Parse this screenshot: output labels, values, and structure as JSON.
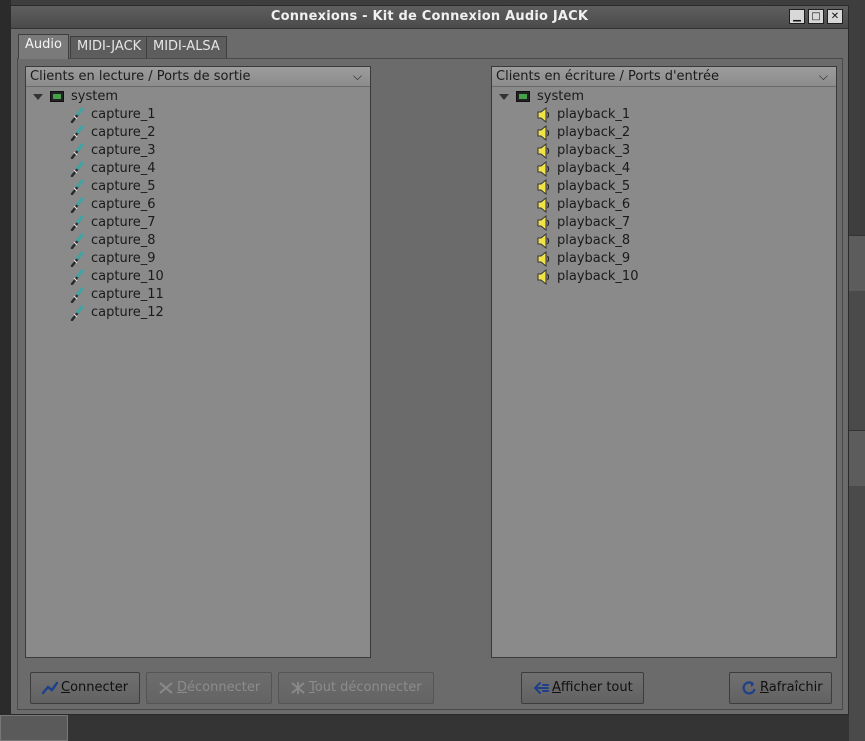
{
  "window": {
    "title": "Connexions - Kit de Connexion Audio JACK",
    "controls": {
      "minimize": "▁",
      "maximize": "□",
      "close": "✕"
    }
  },
  "tabs": [
    {
      "label": "Audio",
      "active": true
    },
    {
      "label": "MIDI-JACK",
      "active": false
    },
    {
      "label": "MIDI-ALSA",
      "active": false
    }
  ],
  "left_panel": {
    "header": "Clients en lecture / Ports de sortie",
    "client": "system",
    "ports": [
      "capture_1",
      "capture_2",
      "capture_3",
      "capture_4",
      "capture_5",
      "capture_6",
      "capture_7",
      "capture_8",
      "capture_9",
      "capture_10",
      "capture_11",
      "capture_12"
    ]
  },
  "right_panel": {
    "header": "Clients en écriture / Ports d'entrée",
    "client": "system",
    "ports": [
      "playback_1",
      "playback_2",
      "playback_3",
      "playback_4",
      "playback_5",
      "playback_6",
      "playback_7",
      "playback_8",
      "playback_9",
      "playback_10"
    ]
  },
  "buttons": {
    "connect": {
      "mnemonic": "C",
      "rest": "onnecter"
    },
    "disconnect": {
      "mnemonic": "D",
      "rest": "éconnecter"
    },
    "disconnect_all": {
      "mnemonic": "T",
      "rest": "out déconnecter"
    },
    "show_all": {
      "mnemonic": "A",
      "rest": "fficher tout"
    },
    "refresh": {
      "mnemonic": "R",
      "rest": "afraîchir"
    }
  },
  "icons": {
    "client": "audio-card-icon",
    "output_port": "audio-jack-plug-icon",
    "input_port": "speaker-icon",
    "connect": "connect-icon",
    "disconnect": "disconnect-icon",
    "show_all": "show-all-arrow-icon",
    "refresh": "refresh-icon"
  },
  "colors": {
    "window_bg": "#6b6b6b",
    "tree_bg": "#8a8a8a",
    "speaker": "#f2e24a",
    "plug": "#3aa6a6"
  }
}
